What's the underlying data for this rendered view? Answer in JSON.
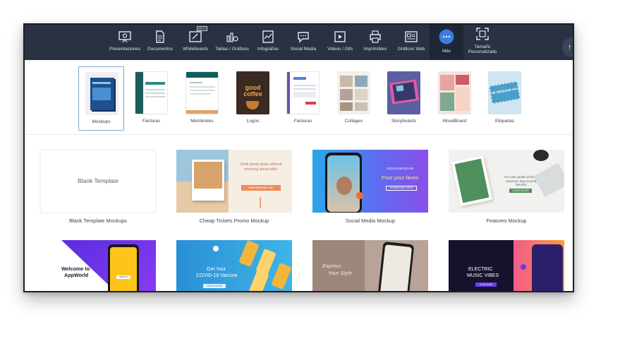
{
  "topbar": {
    "categories": [
      {
        "label": "Presentaciones",
        "icon": "presentation-icon"
      },
      {
        "label": "Documentos",
        "icon": "document-icon"
      },
      {
        "label": "Whiteboards",
        "icon": "whiteboard-icon",
        "badge": "BETA"
      },
      {
        "label": "Tablas / Gráficos",
        "icon": "chart-icon"
      },
      {
        "label": "Infografías",
        "icon": "infographic-icon"
      },
      {
        "label": "Social Media",
        "icon": "social-media-icon"
      },
      {
        "label": "Videos / Gifs",
        "icon": "video-icon"
      },
      {
        "label": "Imprimibles",
        "icon": "printer-icon"
      },
      {
        "label": "Gráficos Web",
        "icon": "web-graphics-icon"
      },
      {
        "label": "Más",
        "icon": "more-icon",
        "active": true
      },
      {
        "label_line1": "Tamaño",
        "label_line2": "Personalizado",
        "icon": "custom-size-icon"
      }
    ],
    "scroll_top_icon": "arrow-up-icon",
    "scroll_top_glyph": "↑"
  },
  "subcategories": [
    {
      "label": "Mockups",
      "selected": true
    },
    {
      "label": "Facturas"
    },
    {
      "label": "Membretes"
    },
    {
      "label": "Logos",
      "thumb_text_1": "good",
      "thumb_text_2": "coffee"
    },
    {
      "label": "Facturas"
    },
    {
      "label": "Collages"
    },
    {
      "label": "Storyboards"
    },
    {
      "label": "MoodBoard"
    },
    {
      "label": "Etiquetas",
      "thumb_text": "THE WEEKEND SALE"
    }
  ],
  "templates": {
    "row1": [
      {
        "caption": "Blank Template Mockups",
        "inner_text": "Blank Template"
      },
      {
        "caption": "Cheap Tickets Promo Mockup",
        "headline": "Grab great deals without worrying about bills!",
        "button_text": "www.bravetix.com"
      },
      {
        "caption": "Social Media Mockup",
        "brand": "SQUAREGRAM",
        "headline": "Post your faves",
        "button_text": "DOWNLOAD NOW"
      },
      {
        "caption": "Features Mockup",
        "headline": "Our new update provides maximum data security benefits",
        "button_text": "LEARN MORE"
      }
    ],
    "row2": [
      {
        "headline_1": "Welcome to",
        "headline_2": "AppWorld",
        "button_text": "SIGNUP"
      },
      {
        "headline_1": "Get Your",
        "headline_2": "COVID-19 Vaccine",
        "button_text": "LEARN MORE"
      },
      {
        "headline_1": "Express",
        "headline_2": "Your Style"
      },
      {
        "headline_1": "ELECTRIC",
        "headline_2": "MUSIC VIBES",
        "button_text": "PLAY NOW"
      }
    ]
  },
  "colors": {
    "topbar": "#293142",
    "active": "#1f2736",
    "accent": "#3d7be0"
  }
}
